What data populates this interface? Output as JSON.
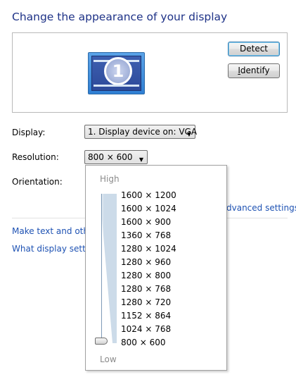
{
  "header": {
    "title": "Change the appearance of your display"
  },
  "preview": {
    "monitor_number": "1",
    "detect_label": "Detect",
    "identify_prefix": "I",
    "identify_rest": "dentify"
  },
  "display": {
    "label": "Display:",
    "value": "1. Display device on: VGA"
  },
  "resolution": {
    "label": "Resolution:",
    "value": "800 × 600",
    "high_label": "High",
    "low_label": "Low",
    "options": [
      "1600 × 1200",
      "1600 × 1024",
      "1600 × 900",
      "1360 × 768",
      "1280 × 1024",
      "1280 × 960",
      "1280 × 800",
      "1280 × 768",
      "1280 × 720",
      "1152 × 864",
      "1024 × 768",
      "800 × 600"
    ],
    "selected_index": 11
  },
  "orientation": {
    "label": "Orientation:"
  },
  "links": {
    "advanced": "dvanced settings",
    "text_size": "Make text and other",
    "which_settings": "What display setting"
  }
}
